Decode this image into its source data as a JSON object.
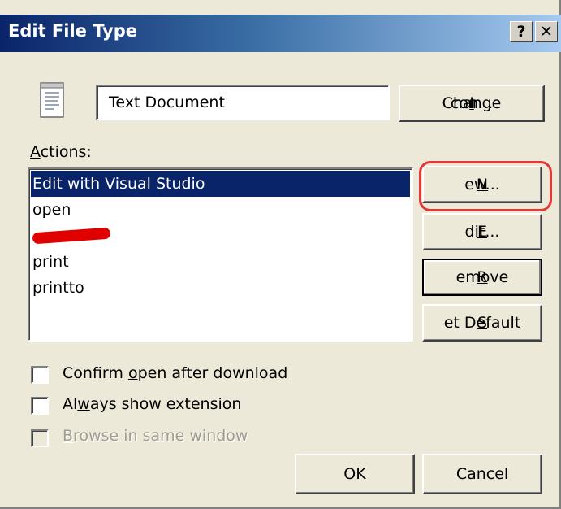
{
  "window": {
    "title": "Edit File Type",
    "help_glyph": "?",
    "close_glyph": "✕"
  },
  "file_type": {
    "icon": "text-document-icon",
    "name": "Text Document",
    "change_icon_pre": "Change ",
    "change_icon_key": "I",
    "change_icon_post": "con..."
  },
  "actions": {
    "label_key": "A",
    "label_rest": "ctions:",
    "items": [
      {
        "label": "Edit with Visual Studio",
        "selected": true
      },
      {
        "label": "open",
        "selected": false
      },
      {
        "label": "",
        "redacted": true
      },
      {
        "label": "print",
        "selected": false
      },
      {
        "label": "printto",
        "selected": false
      }
    ]
  },
  "buttons": {
    "new_key": "N",
    "new_rest": "ew...",
    "edit_key": "E",
    "edit_rest": "dit...",
    "remove_key": "R",
    "remove_rest": "emove",
    "setdefault_key": "S",
    "setdefault_rest": "et Default",
    "ok": "OK",
    "cancel": "Cancel"
  },
  "options": {
    "confirm_pre": "Confirm ",
    "confirm_key": "o",
    "confirm_post": "pen after download",
    "confirm_checked": false,
    "always_pre": "Al",
    "always_key": "w",
    "always_post": "ays show extension",
    "always_checked": false,
    "browse_key": "B",
    "browse_post": "rowse in same window",
    "browse_enabled": false
  },
  "colors": {
    "titlebar_start": "#0a246a",
    "selection": "#0a246a",
    "highlight_annotation": "#e23838",
    "dialog_bg": "#ece9d8"
  }
}
